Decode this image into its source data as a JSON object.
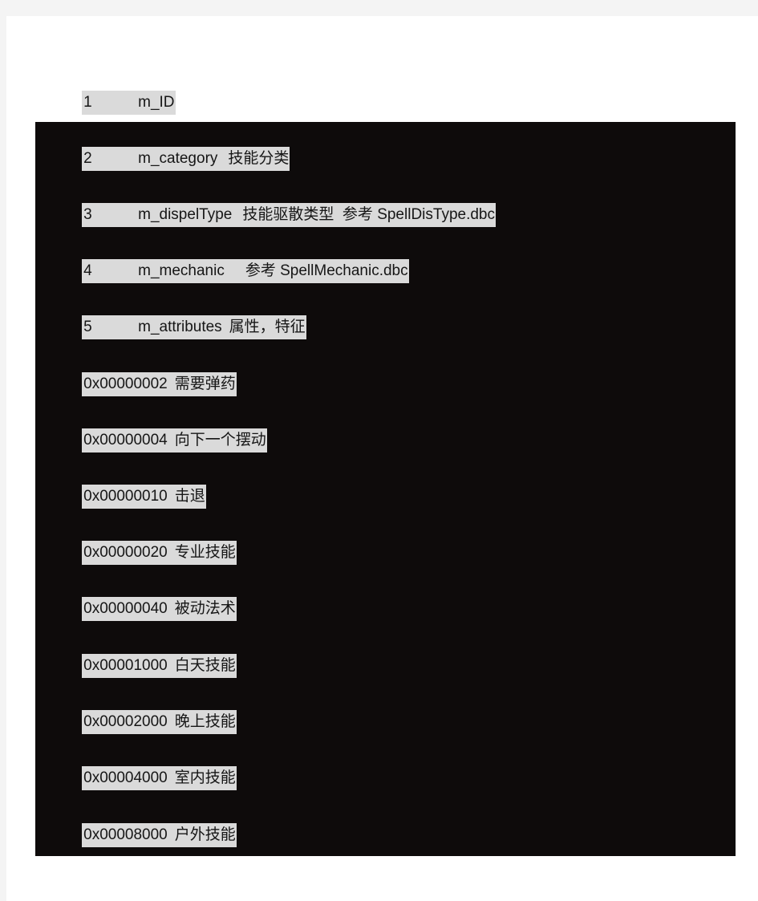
{
  "page": {
    "background_color": "#f4f4f4",
    "sheet_color": "#ffffff",
    "code_block_color": "#0e0b0b",
    "highlight_color": "#dadada",
    "text_color": "#161616"
  },
  "header_line": {
    "index": "1",
    "name": "m_ID",
    "comment": ""
  },
  "field_lines": [
    {
      "index": "2",
      "name": "m_category",
      "comment": "技能分类"
    },
    {
      "index": "3",
      "name": "m_dispelType",
      "comment": "技能驱散类型  参考 SpellDisType.dbc"
    },
    {
      "index": "4",
      "name": "m_mechanic",
      "comment": "参考 SpellMechanic.dbc"
    },
    {
      "index": "5",
      "name": "m_attributes",
      "comment": "属性，特征"
    }
  ],
  "flag_lines": [
    {
      "value": "0x00000002",
      "comment": "需要弹药"
    },
    {
      "value": "0x00000004",
      "comment": "向下一个摆动"
    },
    {
      "value": "0x00000010",
      "comment": "击退"
    },
    {
      "value": "0x00000020",
      "comment": "专业技能"
    },
    {
      "value": "0x00000040",
      "comment": "被动法术"
    },
    {
      "value": "0x00001000",
      "comment": "白天技能"
    },
    {
      "value": "0x00002000",
      "comment": "晚上技能"
    },
    {
      "value": "0x00004000",
      "comment": "室内技能"
    },
    {
      "value": "0x00008000",
      "comment": "户外技能"
    }
  ]
}
